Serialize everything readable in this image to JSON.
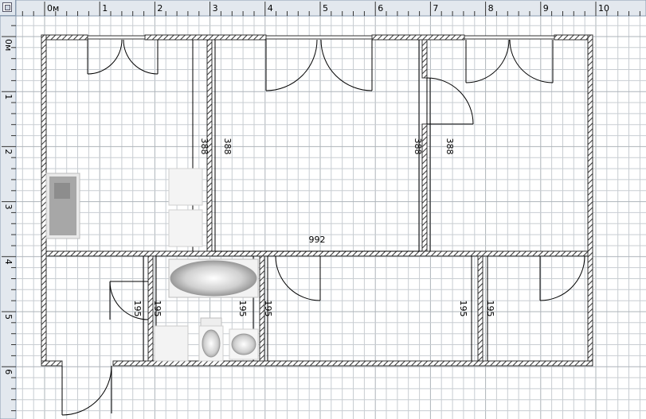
{
  "ruler": {
    "x_labels": [
      "0м",
      "1",
      "2",
      "3",
      "4",
      "5",
      "6",
      "7",
      "8",
      "9",
      "10"
    ],
    "y_labels": [
      "0м",
      "1",
      "2",
      "3",
      "4",
      "5",
      "6"
    ]
  },
  "dimensions": {
    "d1": "388",
    "d2": "388",
    "d3": "388",
    "d4": "388",
    "d5": "992",
    "d6": "195",
    "d7": "195",
    "d8": "195",
    "d9": "195",
    "d10": "195",
    "d11": "195"
  },
  "colors": {
    "grid": "#c8cdd2",
    "grid_major": "#aeb4ba",
    "ruler_bg": "#e3e8ee",
    "wall": "#333333",
    "ink": "#000000"
  }
}
